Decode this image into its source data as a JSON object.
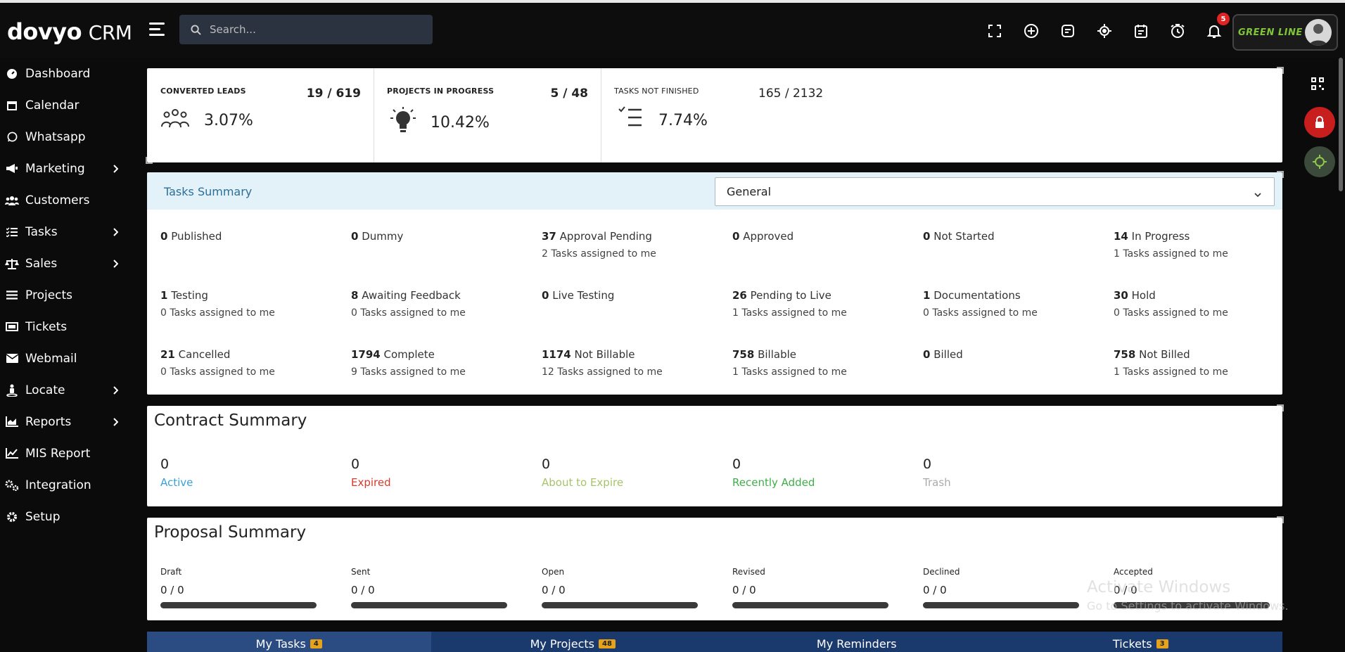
{
  "header": {
    "logo_brand": "dovyo",
    "logo_suffix": "CRM",
    "search_placeholder": "Search...",
    "notification_count": "5",
    "brand_logo_text": "GREEN LINE"
  },
  "sidebar": {
    "items": [
      {
        "label": "Dashboard"
      },
      {
        "label": "Calendar"
      },
      {
        "label": "Whatsapp"
      },
      {
        "label": "Marketing"
      },
      {
        "label": "Customers"
      },
      {
        "label": "Tasks"
      },
      {
        "label": "Sales"
      },
      {
        "label": "Projects"
      },
      {
        "label": "Tickets"
      },
      {
        "label": "Webmail"
      },
      {
        "label": "Locate"
      },
      {
        "label": "Reports"
      },
      {
        "label": "MIS Report"
      },
      {
        "label": "Integration"
      },
      {
        "label": "Setup"
      }
    ]
  },
  "stats": {
    "converted": {
      "title": "CONVERTED LEADS",
      "ratio": "19 / 619",
      "pct": "3.07%"
    },
    "projects": {
      "title": "PROJECTS IN PROGRESS",
      "ratio": "5 / 48",
      "pct": "10.42%"
    },
    "tasks": {
      "title": "TASKS NOT FINISHED",
      "ratio": "165 / 2132",
      "pct": "7.74%"
    }
  },
  "tasks_summary": {
    "title": "Tasks Summary",
    "select_value": "General",
    "items": [
      {
        "count": "0",
        "label": "Published",
        "sub": ""
      },
      {
        "count": "0",
        "label": "Dummy",
        "sub": ""
      },
      {
        "count": "37",
        "label": "Approval Pending",
        "sub": "2 Tasks assigned to me"
      },
      {
        "count": "0",
        "label": "Approved",
        "sub": ""
      },
      {
        "count": "0",
        "label": "Not Started",
        "sub": ""
      },
      {
        "count": "14",
        "label": "In Progress",
        "sub": "1 Tasks assigned to me"
      },
      {
        "count": "1",
        "label": "Testing",
        "sub": "0 Tasks assigned to me"
      },
      {
        "count": "8",
        "label": "Awaiting Feedback",
        "sub": "0 Tasks assigned to me"
      },
      {
        "count": "0",
        "label": "Live Testing",
        "sub": ""
      },
      {
        "count": "26",
        "label": "Pending to Live",
        "sub": "1 Tasks assigned to me"
      },
      {
        "count": "1",
        "label": "Documentations",
        "sub": "0 Tasks assigned to me"
      },
      {
        "count": "30",
        "label": "Hold",
        "sub": "0 Tasks assigned to me"
      },
      {
        "count": "21",
        "label": "Cancelled",
        "sub": "0 Tasks assigned to me"
      },
      {
        "count": "1794",
        "label": "Complete",
        "sub": "9 Tasks assigned to me"
      },
      {
        "count": "1174",
        "label": "Not Billable",
        "sub": "12 Tasks assigned to me"
      },
      {
        "count": "758",
        "label": "Billable",
        "sub": "1 Tasks assigned to me"
      },
      {
        "count": "0",
        "label": "Billed",
        "sub": ""
      },
      {
        "count": "758",
        "label": "Not Billed",
        "sub": "1 Tasks assigned to me"
      }
    ]
  },
  "contract_summary": {
    "title": "Contract Summary",
    "items": [
      {
        "value": "0",
        "label": "Active",
        "color": "#3aa0d8"
      },
      {
        "value": "0",
        "label": "Expired",
        "color": "#d93a2b"
      },
      {
        "value": "0",
        "label": "About to Expire",
        "color": "#a6c36a"
      },
      {
        "value": "0",
        "label": "Recently Added",
        "color": "#3fae49"
      },
      {
        "value": "0",
        "label": "Trash",
        "color": "#aaaaaa"
      }
    ]
  },
  "proposal_summary": {
    "title": "Proposal Summary",
    "items": [
      {
        "label": "Draft",
        "value": "0 / 0",
        "progress": 0
      },
      {
        "label": "Sent",
        "value": "0 / 0",
        "progress": 0
      },
      {
        "label": "Open",
        "value": "0 / 0",
        "progress": 0
      },
      {
        "label": "Revised",
        "value": "0 / 0",
        "progress": 0
      },
      {
        "label": "Declined",
        "value": "0 / 0",
        "progress": 0
      },
      {
        "label": "Accepted",
        "value": "0 / 0",
        "progress": 0
      }
    ]
  },
  "tabs": [
    {
      "label": "My Tasks",
      "count": "4"
    },
    {
      "label": "My Projects",
      "count": "48"
    },
    {
      "label": "My Reminders",
      "count": ""
    },
    {
      "label": "Tickets",
      "count": "3"
    }
  ],
  "watermark": {
    "line1": "Activate Windows",
    "line2": "Go to Settings to activate Windows."
  },
  "colors": {
    "accent_blue": "#2b6f98",
    "tabs_bg": "#1a3a6e",
    "danger": "#c81e1e"
  }
}
